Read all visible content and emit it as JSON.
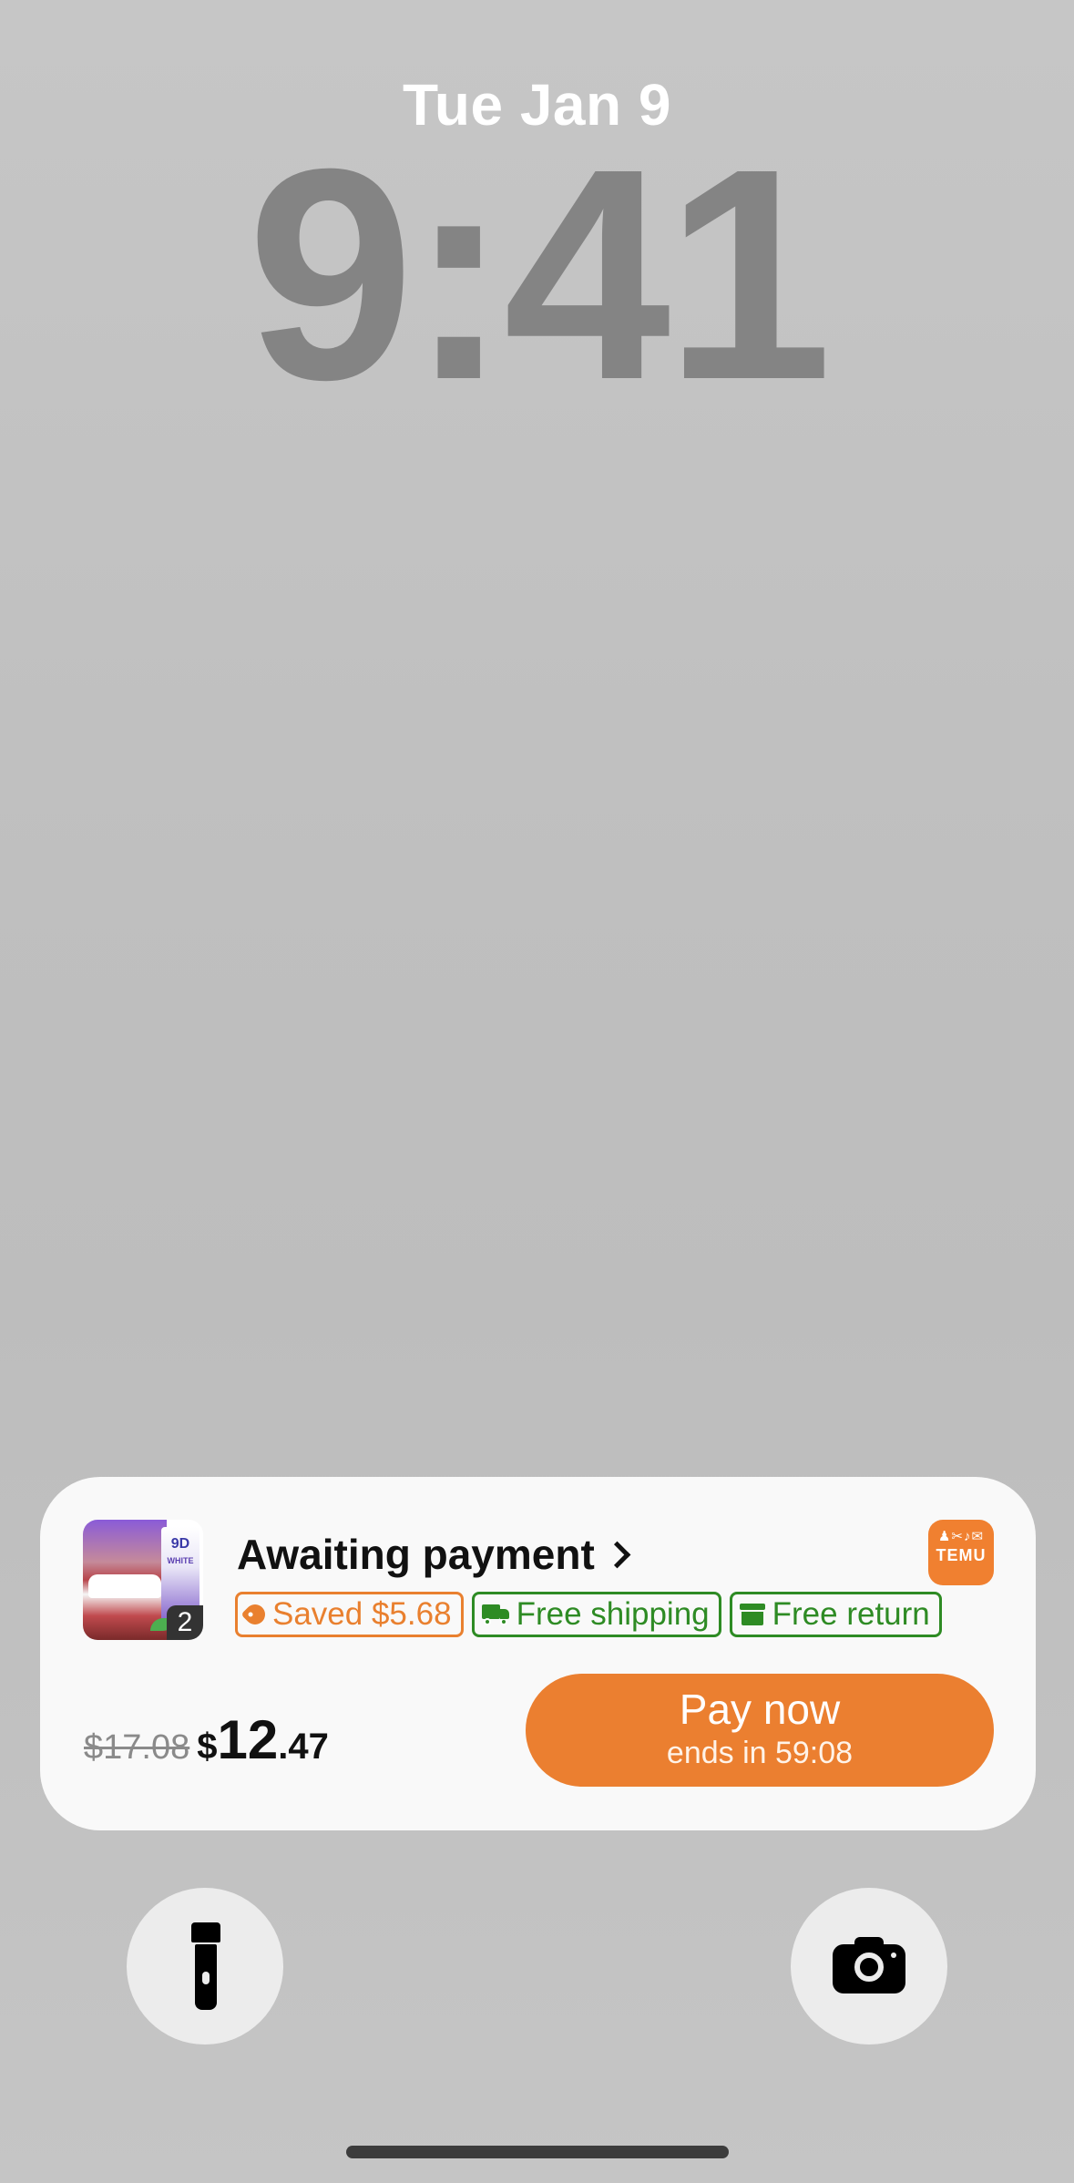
{
  "lockscreen": {
    "date": "Tue Jan 9",
    "time": "9:41"
  },
  "notification": {
    "app": "TEMU",
    "logo_icon": "temu-logo-icon",
    "title": "Awaiting payment",
    "thumbnail": {
      "product_label": "9D",
      "product_sub": "WHITE",
      "item_count": "2"
    },
    "chips": [
      {
        "label": "Saved $5.68",
        "icon": "tag-icon",
        "color": "#e9802f"
      },
      {
        "label": "Free shipping",
        "icon": "truck-icon",
        "color": "#2e8b24"
      },
      {
        "label": "Free return",
        "icon": "return-box-icon",
        "color": "#2e8b24"
      }
    ],
    "price": {
      "original": "$17.08",
      "currency": "$",
      "whole": "12",
      "fraction": ".47"
    },
    "pay_button": {
      "label": "Pay now",
      "subtext": "ends in 59:08",
      "color": "#eb7f30"
    }
  },
  "quick_actions": {
    "left_icon": "flashlight-icon",
    "right_icon": "camera-icon"
  }
}
